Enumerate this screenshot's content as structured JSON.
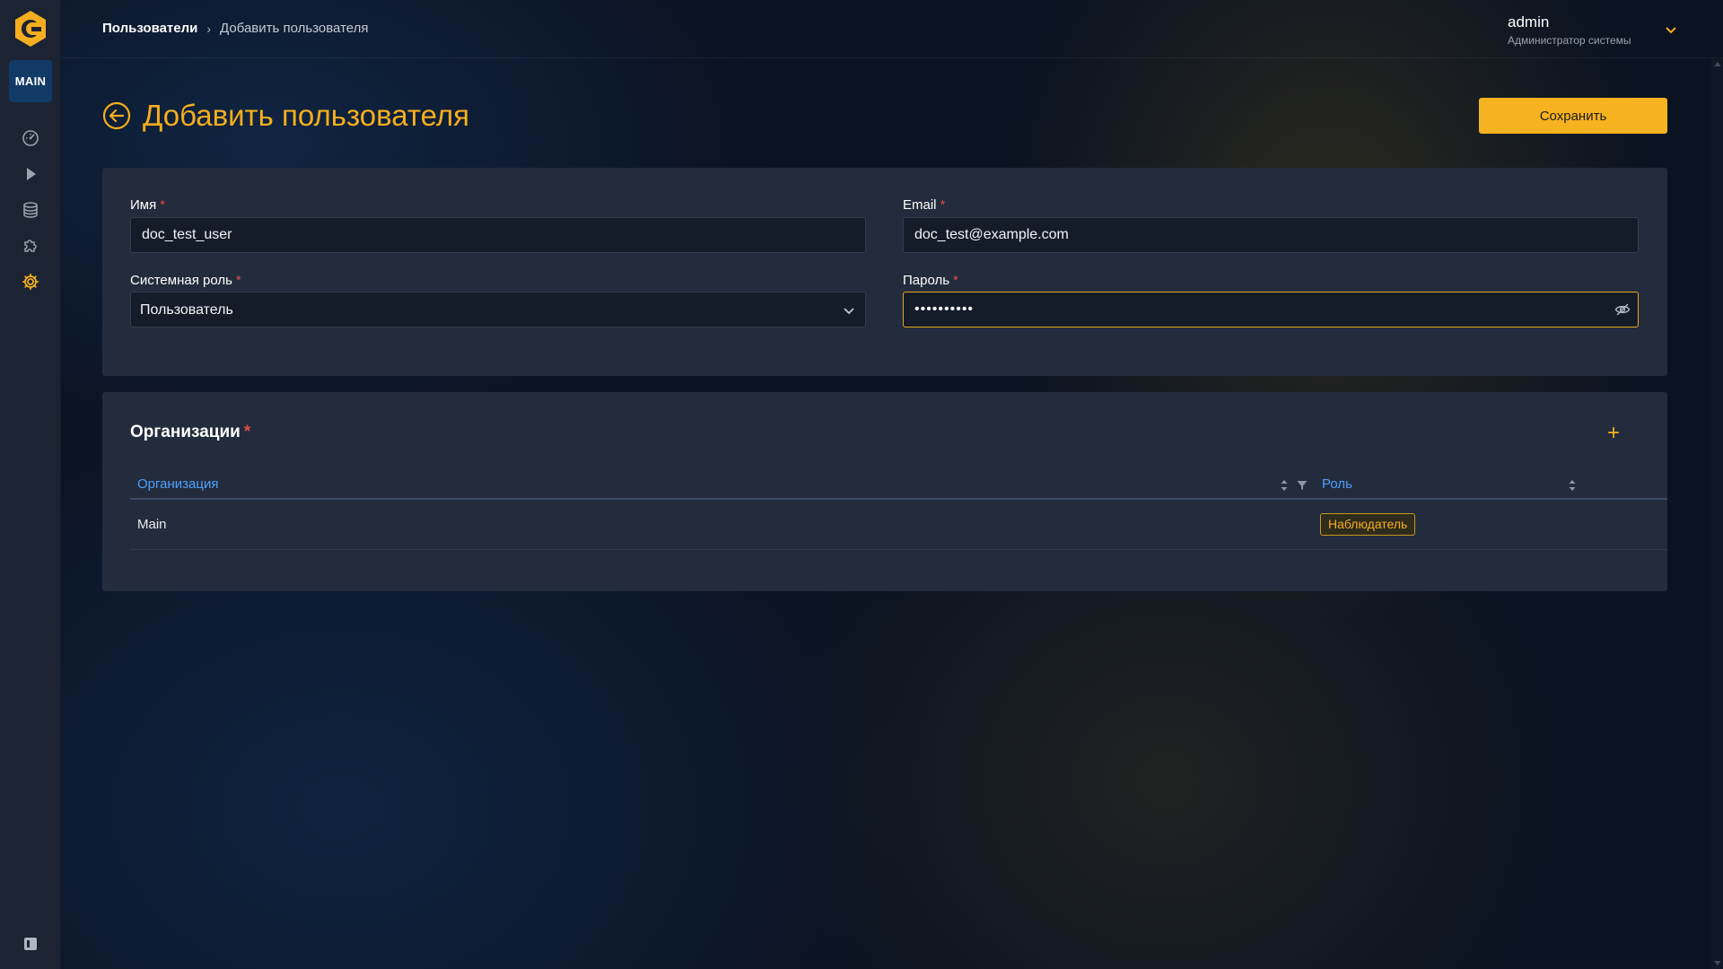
{
  "sidebar": {
    "workspace_badge": "MAIN",
    "items": [
      {
        "icon": "dashboard-icon"
      },
      {
        "icon": "play-icon"
      },
      {
        "icon": "database-icon"
      },
      {
        "icon": "puzzle-icon"
      },
      {
        "icon": "gear-icon",
        "active": true
      }
    ]
  },
  "breadcrumb": {
    "parent": "Пользователи",
    "current": "Добавить пользователя"
  },
  "user": {
    "name": "admin",
    "role": "Администратор системы"
  },
  "page": {
    "title": "Добавить пользователя",
    "save_label": "Сохранить"
  },
  "form": {
    "name": {
      "label": "Имя",
      "required_mark": "*",
      "value": "doc_test_user"
    },
    "email": {
      "label": "Email",
      "required_mark": "*",
      "value": "doc_test@example.com"
    },
    "system_role": {
      "label": "Системная роль",
      "required_mark": "*",
      "value": "Пользователь"
    },
    "password": {
      "label": "Пароль",
      "required_mark": "*",
      "value": "••••••••••"
    }
  },
  "organizations": {
    "title": "Организации",
    "required_mark": "*",
    "add_label": "+",
    "columns": {
      "organization": "Организация",
      "role": "Роль"
    },
    "rows": [
      {
        "organization": "Main",
        "role": "Наблюдатель"
      }
    ]
  },
  "colors": {
    "accent": "#f5ae1e",
    "link": "#4ea0ff",
    "required": "#e24b4b",
    "card": "#222c3c",
    "sidebar": "#1c2433"
  }
}
